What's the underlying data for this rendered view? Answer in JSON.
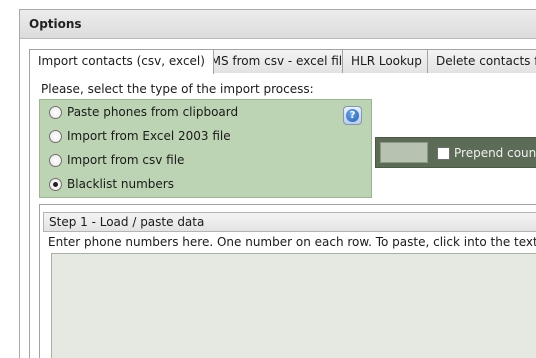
{
  "window": {
    "title": "Options"
  },
  "tabs": [
    {
      "label": "Import contacts (csv, excel)",
      "active": true
    },
    {
      "label": "SMS from csv - excel file",
      "active": false
    },
    {
      "label": "HLR Lookup",
      "active": false
    },
    {
      "label": "Delete contacts fro",
      "active": false
    }
  ],
  "import": {
    "prompt": "Please, select the type of the import process:",
    "options": [
      {
        "label": "Paste phones from clipboard",
        "checked": false
      },
      {
        "label": "Import from Excel 2003 file",
        "checked": false
      },
      {
        "label": "Import from csv file",
        "checked": false
      },
      {
        "label": "Blacklist numbers",
        "checked": true
      }
    ],
    "help_icon": "question-mark-icon"
  },
  "prefix_bar": {
    "checkbox_label": "Prepend countr",
    "checked": false
  },
  "step": {
    "title": "Step 1 - Load / paste data",
    "instructions": "Enter phone numbers here. One number on each row. To paste, click into the textbox and j",
    "textarea_value": ""
  },
  "colors": {
    "radio_panel_bg": "#bdd4b4",
    "dark_bar_bg": "#5c6b55",
    "paste_area_bg": "#e5e9e2"
  }
}
